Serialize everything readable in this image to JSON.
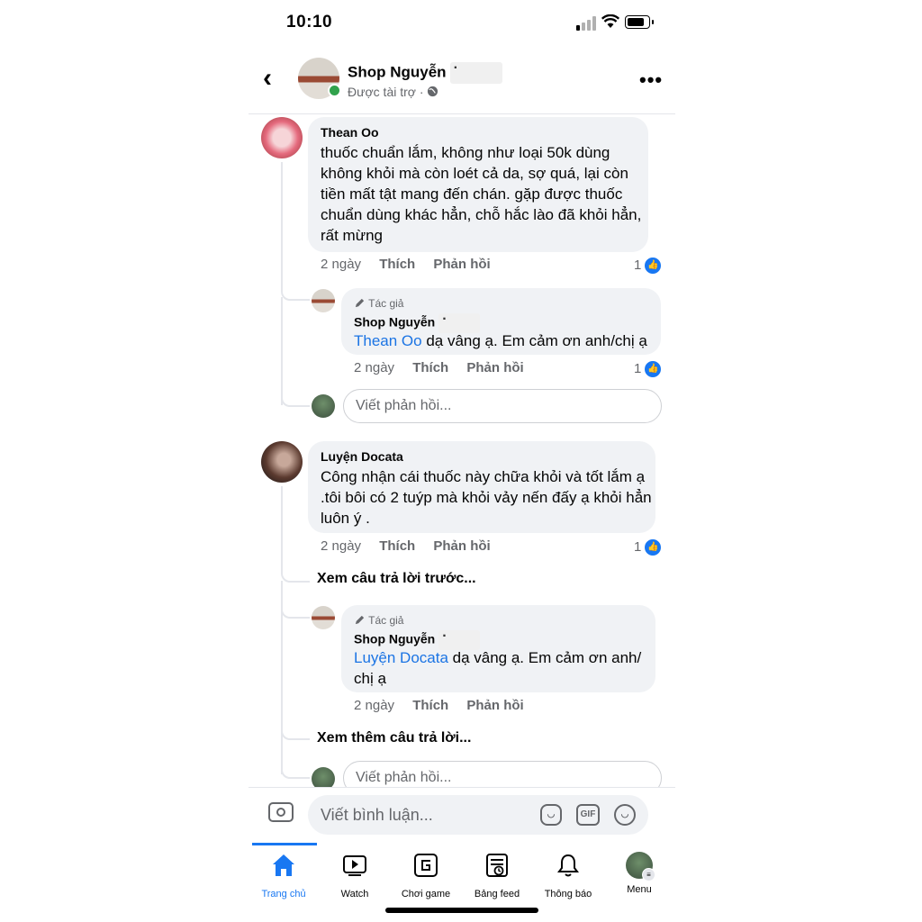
{
  "status": {
    "time": "10:10"
  },
  "header": {
    "page_name": "Shop Nguyễn",
    "subtitle": "Được tài trợ ·",
    "icons": [
      "back-arrow-icon",
      "globe-icon",
      "more-options-icon"
    ]
  },
  "comments": [
    {
      "author": "Thean Oo",
      "text": "thuốc chuẩn lắm, không như loại 50k dùng không khỏi mà còn loét cả da, sợ quá, lại còn tiền mất tật mang đến chán. gặp được thuốc chuẩn dùng khác hẳn, chỗ hắc lào đã khỏi hẳn, rất mừng",
      "time": "2 ngày",
      "like": "Thích",
      "reply": "Phản hồi",
      "likes": "1",
      "replies": [
        {
          "badge": "Tác giả",
          "author": "Shop Nguyễn",
          "mention": "Thean Oo",
          "text": " dạ vâng ạ. Em cảm ơn anh/chị ạ",
          "time": "2 ngày",
          "like": "Thích",
          "reply": "Phản hồi",
          "likes": "1"
        }
      ],
      "reply_placeholder": "Viết phản hồi..."
    },
    {
      "author": "Luyện Docata",
      "text": "Công nhận cái thuốc này chữa khỏi và tốt lắm ạ .tôi bôi có 2 tuýp mà khỏi vảy nến đấy ạ khỏi hẳn luôn ý .",
      "time": "2 ngày",
      "like": "Thích",
      "reply": "Phản hồi",
      "likes": "1",
      "view_previous": "Xem câu trả lời trước...",
      "replies": [
        {
          "badge": "Tác giả",
          "author": "Shop Nguyễn",
          "mention": "Luyện Docata",
          "text": " dạ vâng ạ. Em cảm ơn anh/ chị  ạ",
          "time": "2 ngày",
          "like": "Thích",
          "reply": "Phản hồi"
        }
      ],
      "view_more": "Xem thêm câu trả lời...",
      "reply_placeholder": "Viết phản hồi..."
    }
  ],
  "composer": {
    "placeholder": "Viết bình luận...",
    "gif_label": "GIF"
  },
  "tabs": [
    {
      "label": "Trang chủ",
      "icon": "home-icon",
      "active": true
    },
    {
      "label": "Watch",
      "icon": "watch-icon",
      "active": false
    },
    {
      "label": "Chơi game",
      "icon": "gaming-icon",
      "active": false
    },
    {
      "label": "Bảng feed",
      "icon": "feed-icon",
      "active": false
    },
    {
      "label": "Thông báo",
      "icon": "bell-icon",
      "active": false
    },
    {
      "label": "Menu",
      "icon": "menu-avatar-icon",
      "active": false
    }
  ],
  "colors": {
    "accent": "#1877f2",
    "bubble": "#f0f2f5",
    "link": "#1b74e4",
    "online": "#31a24c"
  }
}
